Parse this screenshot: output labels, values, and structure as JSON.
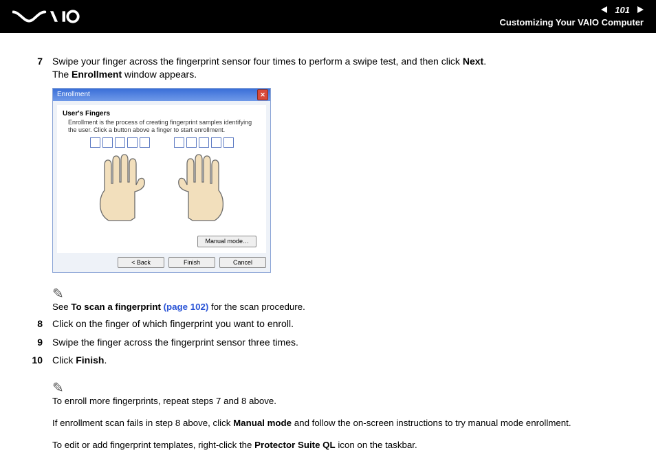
{
  "header": {
    "page_number": "101",
    "section": "Customizing Your VAIO Computer"
  },
  "steps": {
    "s7": {
      "num": "7",
      "line1_a": "Swipe your finger across the fingerprint sensor four times to perform a swipe test, and then click ",
      "line1_b": "Next",
      "line1_c": ".",
      "line2_a": "The ",
      "line2_b": "Enrollment",
      "line2_c": " window appears."
    },
    "s8": {
      "num": "8",
      "text": "Click on the finger of which fingerprint you want to enroll."
    },
    "s9": {
      "num": "9",
      "text": "Swipe the finger across the fingerprint sensor three times."
    },
    "s10": {
      "num": "10",
      "text_a": "Click ",
      "text_b": "Finish",
      "text_c": "."
    }
  },
  "note1": {
    "pencil": "✎",
    "a": "See ",
    "b": "To scan a fingerprint ",
    "link": "(page 102)",
    "c": " for the scan procedure."
  },
  "note2": {
    "pencil": "✎",
    "l1": "To enroll more fingerprints, repeat steps 7 and 8 above.",
    "l2_a": "If enrollment scan fails in step 8 above, click ",
    "l2_b": "Manual mode",
    "l2_c": " and follow the on-screen instructions to try manual mode enrollment.",
    "l3_a": "To edit or add fingerprint templates, right-click the ",
    "l3_b": "Protector Suite QL",
    "l3_c": " icon on the taskbar."
  },
  "enroll": {
    "title": "Enrollment",
    "uf_title": "User's Fingers",
    "uf_desc": "Enrollment is the process of creating fingerprint samples identifying the user. Click a button above a finger to start enrollment.",
    "manual_mode": "Manual mode…",
    "back": "< Back",
    "finish": "Finish",
    "cancel": "Cancel"
  }
}
